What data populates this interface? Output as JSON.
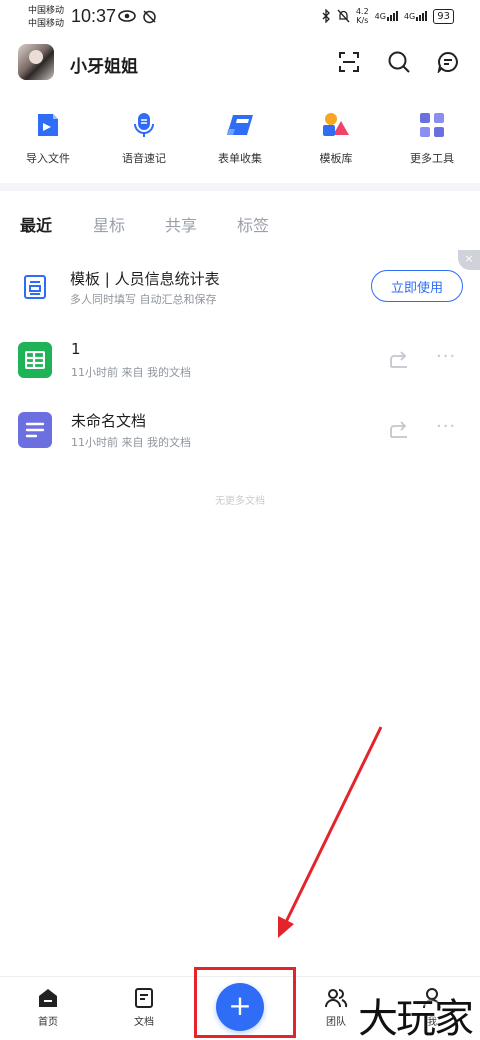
{
  "status_bar": {
    "carrier_1": "中国移动",
    "carrier_2": "中国移动",
    "time": "10:37",
    "speed_value": "4.2",
    "speed_unit": "K/s",
    "net_1": "4G",
    "net_2": "4G",
    "battery": "93"
  },
  "header": {
    "username": "小牙姐姐"
  },
  "tools": [
    {
      "label": "导入文件",
      "icon": "import-file-icon",
      "color": "#2f6df6"
    },
    {
      "label": "语音速记",
      "icon": "microphone-icon",
      "color": "#2f6df6"
    },
    {
      "label": "表单收集",
      "icon": "form-collect-icon",
      "color": "#2f6df6"
    },
    {
      "label": "模板库",
      "icon": "template-shapes-icon",
      "color": "#f5a623"
    },
    {
      "label": "更多工具",
      "icon": "grid-apps-icon",
      "color": "#6b6fe0"
    }
  ],
  "tabs": [
    "最近",
    "星标",
    "共享",
    "标签"
  ],
  "template": {
    "title": "模板 | 人员信息统计表",
    "subtitle": "多人同时填写 自动汇总和保存",
    "button": "立即使用",
    "close": "×"
  },
  "documents": [
    {
      "title": "1",
      "meta": "11小时前  来自 我的文档",
      "icon": "spreadsheet-icon",
      "color": "#1db356"
    },
    {
      "title": "未命名文档",
      "meta": "11小时前  来自 我的文档",
      "icon": "document-icon",
      "color": "#6b6fe0"
    }
  ],
  "more_glyph": "···",
  "no_more": "无更多文档",
  "bottom_nav": {
    "home": "首页",
    "docs": "文档",
    "plus": "+",
    "team": "团队",
    "me": "我"
  },
  "watermark": "大玩家",
  "colors": {
    "accent": "#2f6df6",
    "annotation": "#e3242b"
  }
}
